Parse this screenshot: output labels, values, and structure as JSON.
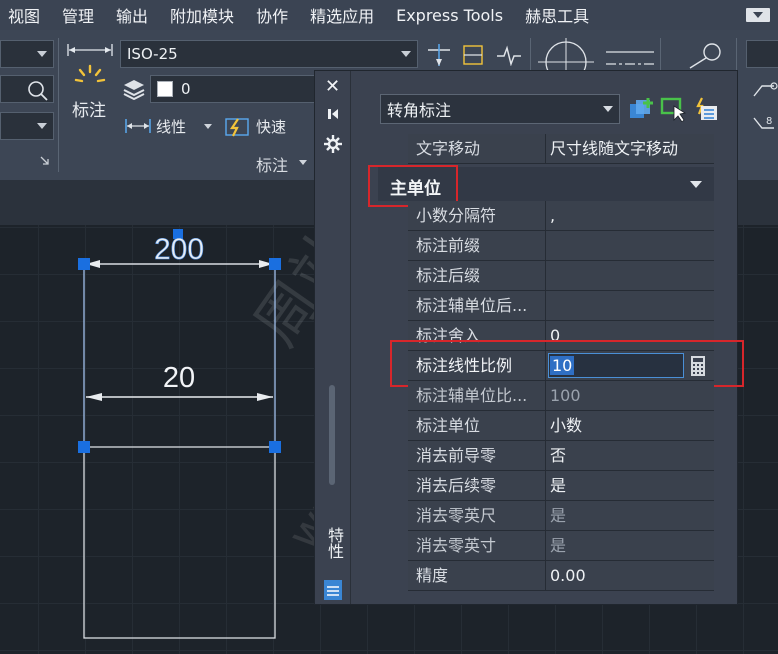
{
  "menu": {
    "items": [
      "视图",
      "管理",
      "输出",
      "附加模块",
      "协作",
      "精选应用",
      "Express Tools",
      "赫思工具"
    ]
  },
  "ribbon": {
    "dimstyle_value": "ISO-25",
    "layer_value": "0",
    "big_button_label": "标注",
    "linear_label": "线性",
    "quick_label": "快速",
    "panel_title": "标注"
  },
  "drawing": {
    "top_dim": "200",
    "inner_dim": "20"
  },
  "palette": {
    "object_type": "转角标注",
    "section_title": "主单位",
    "side_title": "特性",
    "rows": [
      {
        "key": "文字移动",
        "value": "尺寸线随文字移动",
        "dim": false
      },
      {
        "key": "小数分隔符",
        "value": ",",
        "dim": false
      },
      {
        "key": "标注前缀",
        "value": "",
        "dim": false
      },
      {
        "key": "标注后缀",
        "value": "",
        "dim": false
      },
      {
        "key": "标注辅单位后...",
        "value": "",
        "dim": false
      },
      {
        "key": "标注舍入",
        "value": "0",
        "dim": false
      },
      {
        "key": "标注线性比例",
        "value": "10",
        "dim": false
      },
      {
        "key": "标注辅单位比...",
        "value": "100",
        "dim": true
      },
      {
        "key": "标注单位",
        "value": "小数",
        "dim": false
      },
      {
        "key": "消去前导零",
        "value": "否",
        "dim": false
      },
      {
        "key": "消去后续零",
        "value": "是",
        "dim": false
      },
      {
        "key": "消去零英尺",
        "value": "是",
        "dim": true
      },
      {
        "key": "消去零英寸",
        "value": "是",
        "dim": true
      },
      {
        "key": "精度",
        "value": "0.00",
        "dim": false
      }
    ]
  },
  "watermark": {
    "line1": "周站长CAD",
    "line2": "www.zzcad.com"
  },
  "colors": {
    "highlight_red": "#d7262b",
    "selection_blue": "#1f6fd6",
    "grip_blue": "#1a6fe0"
  }
}
